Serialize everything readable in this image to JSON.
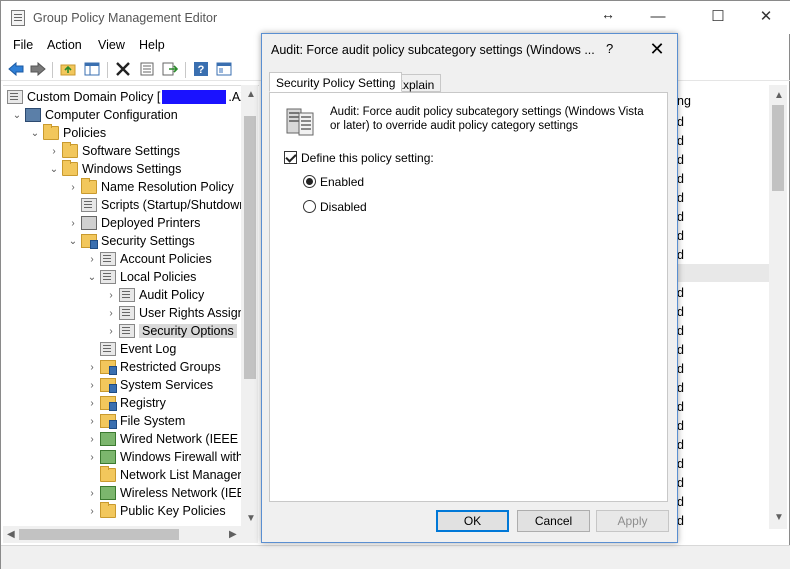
{
  "window": {
    "title": "Group Policy Management Editor",
    "minimize_glyph": "—",
    "maximize_glyph": "☐",
    "close_glyph": "✕",
    "cursor_glyph": "↔"
  },
  "menu": [
    "File",
    "Action",
    "View",
    "Help"
  ],
  "toolbar": {
    "buttons": [
      "back-icon",
      "forward-icon",
      "up-folder-icon",
      "show-hide-tree-icon",
      "delete-icon",
      "properties-icon",
      "export-icon",
      "help-icon",
      "console-icon"
    ]
  },
  "tree": {
    "root_prefix": "Custom Domain Policy [",
    "root_suffix": ".AZU",
    "items": [
      {
        "label": "Computer Configuration"
      },
      {
        "label": "Policies"
      },
      {
        "label": "Software Settings"
      },
      {
        "label": "Windows Settings"
      },
      {
        "label": "Name Resolution Policy"
      },
      {
        "label": "Scripts (Startup/Shutdowr"
      },
      {
        "label": "Deployed Printers"
      },
      {
        "label": "Security Settings"
      },
      {
        "label": "Account Policies"
      },
      {
        "label": "Local Policies"
      },
      {
        "label": "Audit Policy"
      },
      {
        "label": "User Rights Assign"
      },
      {
        "label": "Security Options"
      },
      {
        "label": "Event Log"
      },
      {
        "label": "Restricted Groups"
      },
      {
        "label": "System Services"
      },
      {
        "label": "Registry"
      },
      {
        "label": "File System"
      },
      {
        "label": "Wired Network (IEEE 8"
      },
      {
        "label": "Windows Firewall with"
      },
      {
        "label": "Network List Manager"
      },
      {
        "label": "Wireless Network (IEEE"
      },
      {
        "label": "Public Key Policies"
      }
    ]
  },
  "right_pane": {
    "header_fragment": "ng",
    "cell_fragment": "d"
  },
  "dialog": {
    "title": "Audit: Force audit policy subcategory settings (Windows ...",
    "help_glyph": "?",
    "close_glyph": "✕",
    "tabs": [
      "Security Policy Setting",
      "Explain"
    ],
    "description": "Audit: Force audit policy subcategory settings (Windows Vista or later) to override audit policy category settings",
    "define_label": "Define this policy setting:",
    "define_checked": true,
    "options": [
      {
        "label": "Enabled",
        "selected": true
      },
      {
        "label": "Disabled",
        "selected": false
      }
    ],
    "buttons": {
      "ok": "OK",
      "cancel": "Cancel",
      "apply": "Apply"
    }
  }
}
